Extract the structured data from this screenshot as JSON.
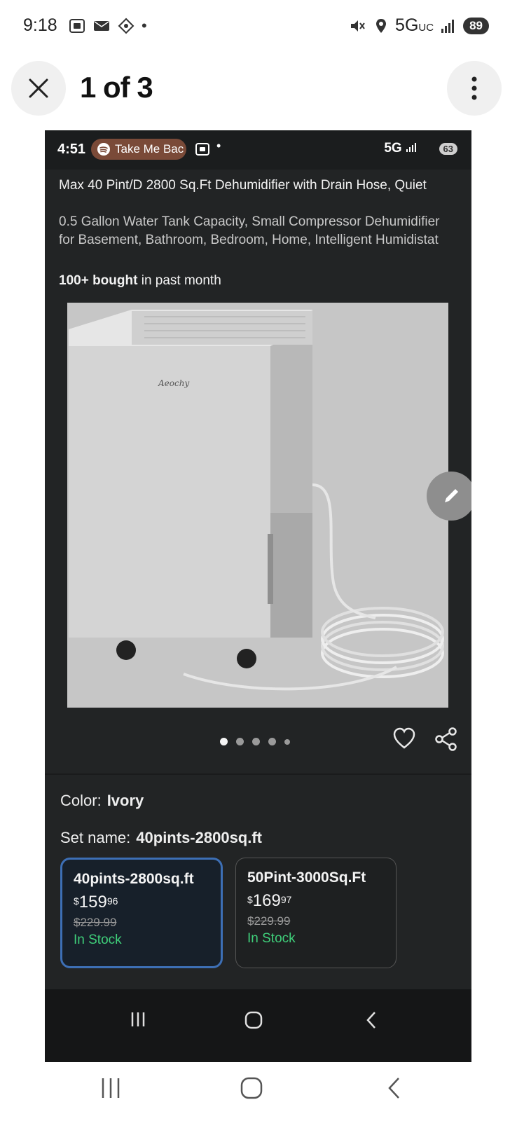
{
  "status_bar": {
    "time": "9:18",
    "network": "5G",
    "network_sub": "UC",
    "battery": "89"
  },
  "viewer": {
    "title": "1 of 3",
    "close_icon": "close-icon",
    "more_icon": "more-vertical-icon"
  },
  "inner_status": {
    "time": "4:51",
    "media_label": "Take Me Bac",
    "network": "5G",
    "battery": "63"
  },
  "product": {
    "title": "Max 40 Pint/D 2800 Sq.Ft Dehumidifier with Drain Hose, Quiet",
    "subtitle": "0.5 Gallon Water Tank Capacity, Small Compressor Dehumidifier for Basement, Bathroom, Bedroom, Home, Intelligent Humidistat",
    "bought_strong": "100+ bought",
    "bought_rest": " in past month",
    "image_brand": "Aeochy",
    "image_dots": {
      "count": 5,
      "active_index": 0
    }
  },
  "color": {
    "label": "Color:",
    "value": "Ivory"
  },
  "set_name": {
    "label": "Set name:",
    "value": "40pints-2800sq.ft"
  },
  "options": [
    {
      "name": "40pints-2800sq.ft",
      "currency": "$",
      "price_whole": "159",
      "price_cents": "96",
      "list_price": "$229.99",
      "stock": "In Stock",
      "selected": true
    },
    {
      "name": "50Pint-3000Sq.Ft",
      "currency": "$",
      "price_whole": "169",
      "price_cents": "97",
      "list_price": "$229.99",
      "stock": "In Stock",
      "selected": false
    }
  ],
  "colors": {
    "inner_bg": "#222425",
    "selected_border": "#3d6fb5",
    "in_stock": "#3fcf7a"
  }
}
